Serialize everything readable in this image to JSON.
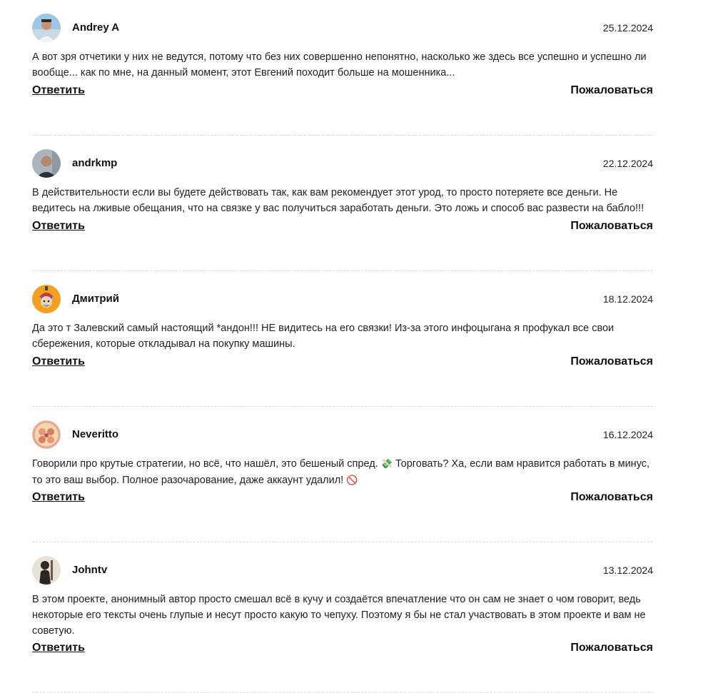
{
  "comments": [
    {
      "username": "Andrey A",
      "date": "25.12.2024",
      "text": "А вот зря отчетики у них не ведутся, потому что без них совершенно непонятно, насколько же здесь все успешно и успешно ли вообще... как по мне, на данный момент, этот Евгений походит больше на мошенника...",
      "reply_label": "Ответить",
      "report_label": "Пожаловаться",
      "avatar_icon": "avatar-photo"
    },
    {
      "username": "andrkmp",
      "date": "22.12.2024",
      "text": "В действительности если вы будете действовать так, как вам рекомендует этот урод, то просто потеряете все деньги. Не ведитесь на лживые обещания, что на связке у вас получиться заработать деньги. Это ложь и способ вас развести на бабло!!!",
      "reply_label": "Ответить",
      "report_label": "Пожаловаться",
      "avatar_icon": "avatar-photo"
    },
    {
      "username": "Дмитрий",
      "date": "18.12.2024",
      "text": "Да это т Залевский самый настоящий *андон!!! НЕ видитесь на его связки! Из-за этого инфоцыгана я профукал все свои сбережения, которые откладывал на покупку машины.",
      "reply_label": "Ответить",
      "report_label": "Пожаловаться",
      "avatar_icon": "avatar-cartoon"
    },
    {
      "username": "Neveritto",
      "date": "16.12.2024",
      "text_before": "Говорили про крутые стратегии, но всё, что нашёл, это бешеный спред.",
      "emoji_1": "💸",
      "text_middle": "Торговать? Ха, если вам нравится работать в минус, то это ваш выбор. Полное разочарование, даже аккаунт удалил!",
      "emoji_2": "🚫",
      "reply_label": "Ответить",
      "report_label": "Пожаловаться",
      "avatar_icon": "avatar-illustration"
    },
    {
      "username": "Johntv",
      "date": "13.12.2024",
      "text": "В этом проекте, анонимный автор просто смешал всё в кучу и создаётся впечатление что он сам не знает о чом говорит, ведь некоторые его тексты очень глупые и несут просто какую то чепуху. Поэтому я бы не стал участвовать в этом проекте и вам не советую.",
      "reply_label": "Ответить",
      "report_label": "Пожаловаться",
      "avatar_icon": "avatar-photo"
    }
  ]
}
